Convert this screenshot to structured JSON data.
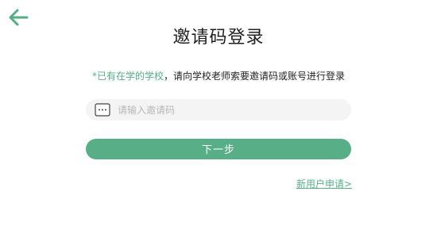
{
  "header": {
    "title": "邀请码登录"
  },
  "hint": {
    "highlight": "*已有在学的学校",
    "rest": "，请向学校老师索要邀请码或账号进行登录"
  },
  "code_input": {
    "placeholder": "请输入邀请码",
    "value": ""
  },
  "next_button": {
    "label": "下一步"
  },
  "register_link": {
    "label": "新用户申请>"
  },
  "colors": {
    "accent": "#58ae86",
    "back_arrow": "#55ad84",
    "input_bg": "#f4f4f4"
  }
}
